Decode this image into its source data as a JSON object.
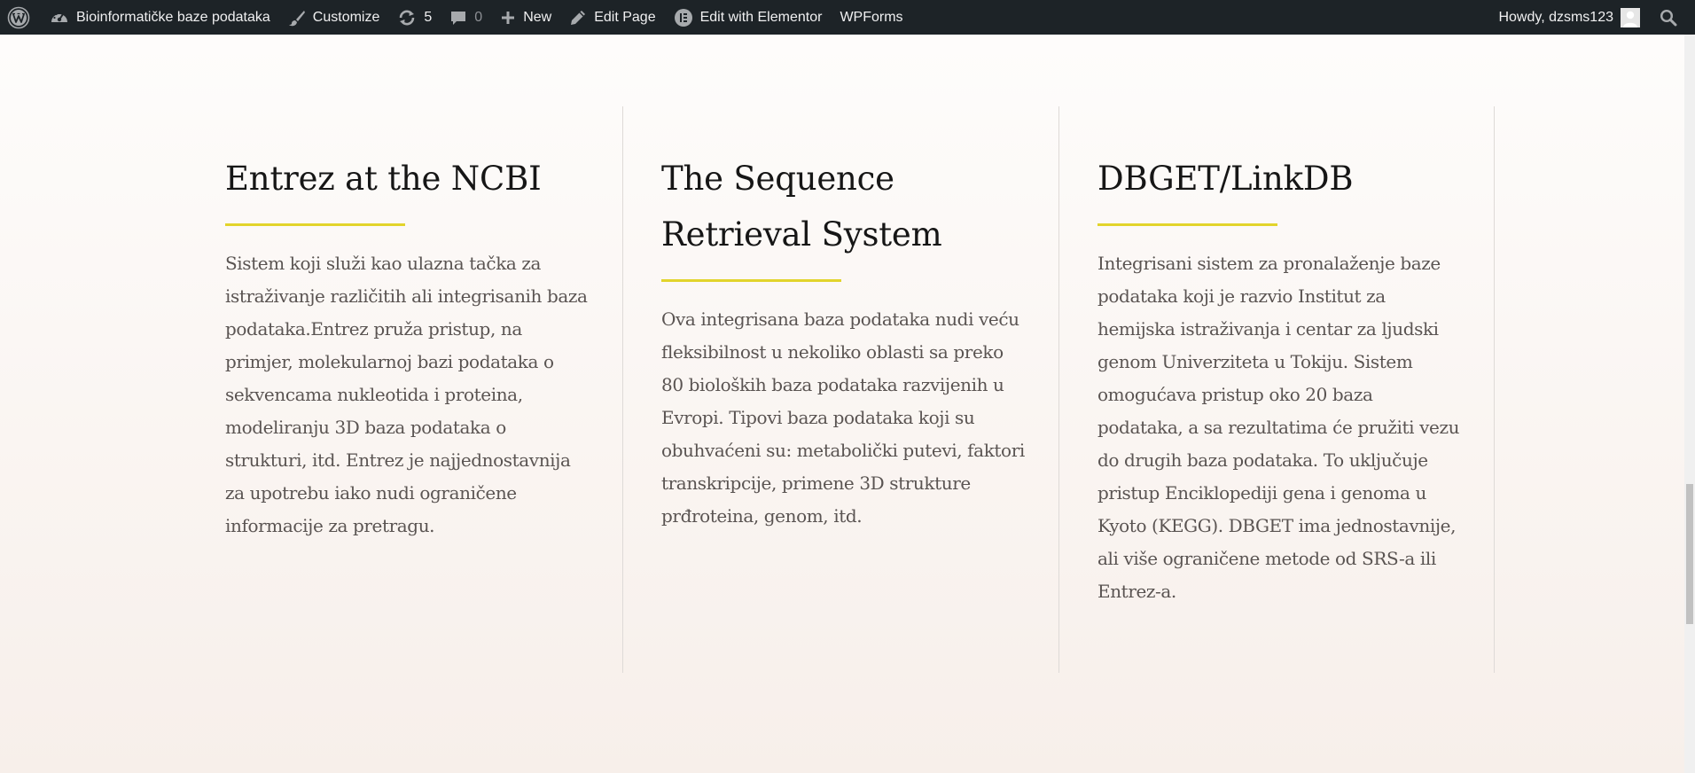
{
  "adminbar": {
    "site_name": "Bioinformatičke baze podataka",
    "customize": "Customize",
    "updates_count": "5",
    "comments_count": "0",
    "new": "New",
    "edit_page": "Edit Page",
    "edit_elementor": "Edit with Elementor",
    "wpforms": "WPForms",
    "howdy": "Howdy, dzsms123"
  },
  "columns": [
    {
      "title": "Entrez at the NCBI",
      "text": "Sistem koji služi kao ulazna tačka za istraživanje različitih ali integrisanih baza podataka.Entrez pruža pristup, na primjer, molekularnoj bazi podataka o sekvencama nukleotida i proteina, modeliranju 3D baza podataka o strukturi, itd. Entrez je najjednostavnija za upotrebu iako nudi ograničene informacije za pretragu."
    },
    {
      "title": "The Sequence Retrieval System",
      "text": "Ova integrisana baza podataka nudi veću fleksibilnost u nekoliko oblasti sa preko 80 bioloških baza podataka razvijenih u Evropi. Tipovi baza podataka koji su obuhvaćeni su: metabolički putevi, faktori transkripcije, primene 3D strukture prđroteina, genom, itd."
    },
    {
      "title": "DBGET/LinkDB",
      "text": "Integrisani sistem za pronalaženje baze podataka koji je razvio Institut za hemijska istraživanja i centar za ljudski genom Univerziteta u Tokiju. Sistem omogućava pristup oko 20 baza podataka, a sa rezultatima će pružiti vezu do drugih baza podataka. To uključuje pristup Enciklopediji gena i genoma u Kyoto (KEGG). DBGET ima jednostavnije, ali više ograničene metode od SRS-a ili Entrez-a."
    }
  ],
  "colors": {
    "adminbar_bg": "#1d2327",
    "accent_underline": "#e2d42b",
    "heading": "#161616",
    "body_text": "#5a5452"
  },
  "icons": [
    "wordpress-logo-icon",
    "dashboard-gauge-icon",
    "brush-icon",
    "updates-icon",
    "comment-icon",
    "plus-icon",
    "pencil-icon",
    "elementor-icon",
    "avatar-icon",
    "search-icon"
  ]
}
